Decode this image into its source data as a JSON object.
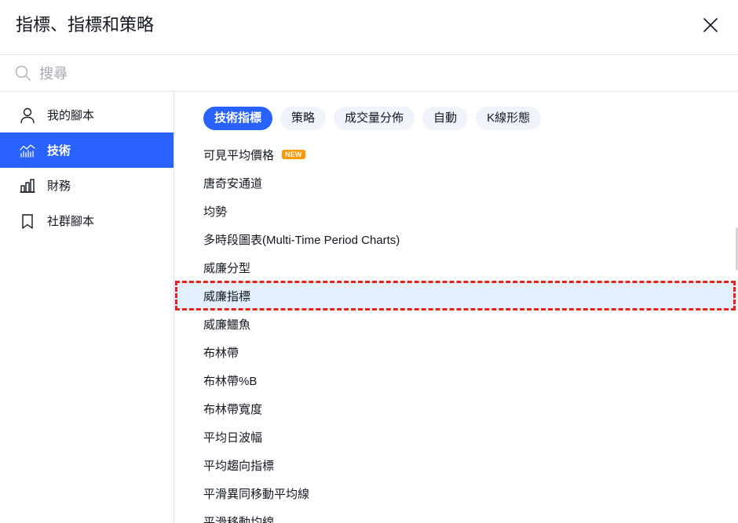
{
  "dialog": {
    "title": "指標、指標和策略",
    "close_icon": "close-icon"
  },
  "search": {
    "icon": "search-icon",
    "placeholder": "搜尋",
    "value": ""
  },
  "sidebar": {
    "items": [
      {
        "label": "我的腳本",
        "icon": "user-icon",
        "active": false
      },
      {
        "label": "技術",
        "icon": "technicals-icon",
        "active": true
      },
      {
        "label": "財務",
        "icon": "bar-chart-icon",
        "active": false
      },
      {
        "label": "社群腳本",
        "icon": "bookmark-icon",
        "active": false
      }
    ]
  },
  "tabs": [
    {
      "label": "技術指標",
      "active": true
    },
    {
      "label": "策略",
      "active": false
    },
    {
      "label": "成交量分佈",
      "active": false
    },
    {
      "label": "自動",
      "active": false
    },
    {
      "label": "K線形態",
      "active": false
    }
  ],
  "list": {
    "items": [
      {
        "label": "可見平均價格",
        "badge": "NEW"
      },
      {
        "label": "唐奇安通道"
      },
      {
        "label": "均勢"
      },
      {
        "label": "多時段圖表(Multi-Time Period Charts)"
      },
      {
        "label": "威廉分型"
      },
      {
        "label": "威廉指標",
        "selected": true
      },
      {
        "label": "威廉鱷魚"
      },
      {
        "label": "布林帶"
      },
      {
        "label": "布林帶%B"
      },
      {
        "label": "布林帶寬度"
      },
      {
        "label": "平均日波幅"
      },
      {
        "label": "平均趨向指標"
      },
      {
        "label": "平滑異同移動平均線"
      },
      {
        "label": "平滑移動均線"
      }
    ]
  },
  "colors": {
    "accent": "#2962ff",
    "text": "#131722",
    "border": "#e0e3eb",
    "pill": "#f0f3fa",
    "badge": "#ff9800",
    "highlight": "#e3effd",
    "annotation": "#e5231b"
  }
}
